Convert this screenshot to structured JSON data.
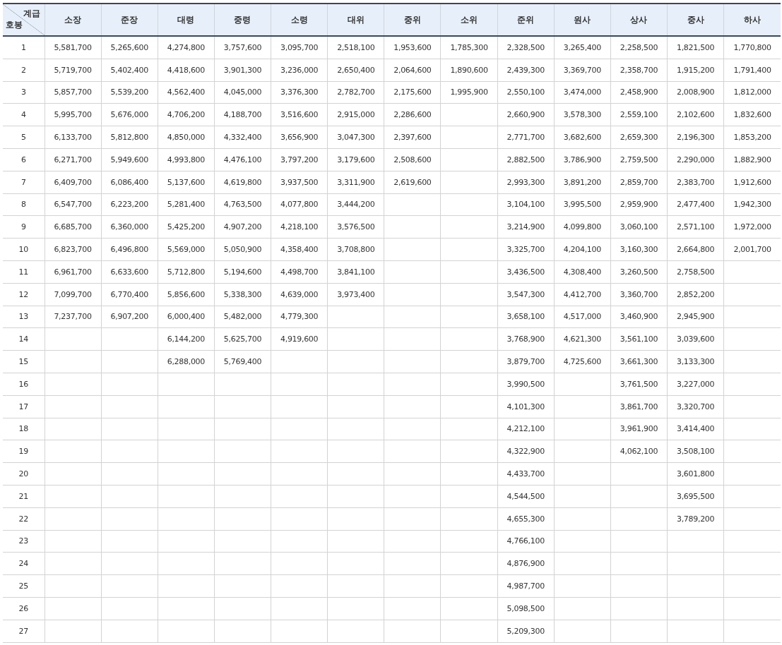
{
  "table": {
    "corner": {
      "column_label": "계급",
      "row_label": "호봉"
    },
    "columns": [
      "소장",
      "준장",
      "대령",
      "중령",
      "소령",
      "대위",
      "중위",
      "소위",
      "준위",
      "원사",
      "상사",
      "중사",
      "하사"
    ],
    "rows": [
      {
        "step": "1",
        "cells": [
          "5,581,700",
          "5,265,600",
          "4,274,800",
          "3,757,600",
          "3,095,700",
          "2,518,100",
          "1,953,600",
          "1,785,300",
          "2,328,500",
          "3,265,400",
          "2,258,500",
          "1,821,500",
          "1,770,800"
        ]
      },
      {
        "step": "2",
        "cells": [
          "5,719,700",
          "5,402,400",
          "4,418,600",
          "3,901,300",
          "3,236,000",
          "2,650,400",
          "2,064,600",
          "1,890,600",
          "2,439,300",
          "3,369,700",
          "2,358,700",
          "1,915,200",
          "1,791,400"
        ]
      },
      {
        "step": "3",
        "cells": [
          "5,857,700",
          "5,539,200",
          "4,562,400",
          "4,045,000",
          "3,376,300",
          "2,782,700",
          "2,175,600",
          "1,995,900",
          "2,550,100",
          "3,474,000",
          "2,458,900",
          "2,008,900",
          "1,812,000"
        ]
      },
      {
        "step": "4",
        "cells": [
          "5,995,700",
          "5,676,000",
          "4,706,200",
          "4,188,700",
          "3,516,600",
          "2,915,000",
          "2,286,600",
          null,
          "2,660,900",
          "3,578,300",
          "2,559,100",
          "2,102,600",
          "1,832,600"
        ]
      },
      {
        "step": "5",
        "cells": [
          "6,133,700",
          "5,812,800",
          "4,850,000",
          "4,332,400",
          "3,656,900",
          "3,047,300",
          "2,397,600",
          null,
          "2,771,700",
          "3,682,600",
          "2,659,300",
          "2,196,300",
          "1,853,200"
        ]
      },
      {
        "step": "6",
        "cells": [
          "6,271,700",
          "5,949,600",
          "4,993,800",
          "4,476,100",
          "3,797,200",
          "3,179,600",
          "2,508,600",
          null,
          "2,882,500",
          "3,786,900",
          "2,759,500",
          "2,290,000",
          "1,882,900"
        ]
      },
      {
        "step": "7",
        "cells": [
          "6,409,700",
          "6,086,400",
          "5,137,600",
          "4,619,800",
          "3,937,500",
          "3,311,900",
          "2,619,600",
          null,
          "2,993,300",
          "3,891,200",
          "2,859,700",
          "2,383,700",
          "1,912,600"
        ]
      },
      {
        "step": "8",
        "cells": [
          "6,547,700",
          "6,223,200",
          "5,281,400",
          "4,763,500",
          "4,077,800",
          "3,444,200",
          null,
          null,
          "3,104,100",
          "3,995,500",
          "2,959,900",
          "2,477,400",
          "1,942,300"
        ]
      },
      {
        "step": "9",
        "cells": [
          "6,685,700",
          "6,360,000",
          "5,425,200",
          "4,907,200",
          "4,218,100",
          "3,576,500",
          null,
          null,
          "3,214,900",
          "4,099,800",
          "3,060,100",
          "2,571,100",
          "1,972,000"
        ]
      },
      {
        "step": "10",
        "cells": [
          "6,823,700",
          "6,496,800",
          "5,569,000",
          "5,050,900",
          "4,358,400",
          "3,708,800",
          null,
          null,
          "3,325,700",
          "4,204,100",
          "3,160,300",
          "2,664,800",
          "2,001,700"
        ]
      },
      {
        "step": "11",
        "cells": [
          "6,961,700",
          "6,633,600",
          "5,712,800",
          "5,194,600",
          "4,498,700",
          "3,841,100",
          null,
          null,
          "3,436,500",
          "4,308,400",
          "3,260,500",
          "2,758,500",
          null
        ]
      },
      {
        "step": "12",
        "cells": [
          "7,099,700",
          "6,770,400",
          "5,856,600",
          "5,338,300",
          "4,639,000",
          "3,973,400",
          null,
          null,
          "3,547,300",
          "4,412,700",
          "3,360,700",
          "2,852,200",
          null
        ]
      },
      {
        "step": "13",
        "cells": [
          "7,237,700",
          "6,907,200",
          "6,000,400",
          "5,482,000",
          "4,779,300",
          null,
          null,
          null,
          "3,658,100",
          "4,517,000",
          "3,460,900",
          "2,945,900",
          null
        ]
      },
      {
        "step": "14",
        "cells": [
          null,
          null,
          "6,144,200",
          "5,625,700",
          "4,919,600",
          null,
          null,
          null,
          "3,768,900",
          "4,621,300",
          "3,561,100",
          "3,039,600",
          null
        ]
      },
      {
        "step": "15",
        "cells": [
          null,
          null,
          "6,288,000",
          "5,769,400",
          null,
          null,
          null,
          null,
          "3,879,700",
          "4,725,600",
          "3,661,300",
          "3,133,300",
          null
        ]
      },
      {
        "step": "16",
        "cells": [
          null,
          null,
          null,
          null,
          null,
          null,
          null,
          null,
          "3,990,500",
          null,
          "3,761,500",
          "3,227,000",
          null
        ]
      },
      {
        "step": "17",
        "cells": [
          null,
          null,
          null,
          null,
          null,
          null,
          null,
          null,
          "4,101,300",
          null,
          "3,861,700",
          "3,320,700",
          null
        ]
      },
      {
        "step": "18",
        "cells": [
          null,
          null,
          null,
          null,
          null,
          null,
          null,
          null,
          "4,212,100",
          null,
          "3,961,900",
          "3,414,400",
          null
        ]
      },
      {
        "step": "19",
        "cells": [
          null,
          null,
          null,
          null,
          null,
          null,
          null,
          null,
          "4,322,900",
          null,
          "4,062,100",
          "3,508,100",
          null
        ]
      },
      {
        "step": "20",
        "cells": [
          null,
          null,
          null,
          null,
          null,
          null,
          null,
          null,
          "4,433,700",
          null,
          null,
          "3,601,800",
          null
        ]
      },
      {
        "step": "21",
        "cells": [
          null,
          null,
          null,
          null,
          null,
          null,
          null,
          null,
          "4,544,500",
          null,
          null,
          "3,695,500",
          null
        ]
      },
      {
        "step": "22",
        "cells": [
          null,
          null,
          null,
          null,
          null,
          null,
          null,
          null,
          "4,655,300",
          null,
          null,
          "3,789,200",
          null
        ]
      },
      {
        "step": "23",
        "cells": [
          null,
          null,
          null,
          null,
          null,
          null,
          null,
          null,
          "4,766,100",
          null,
          null,
          null,
          null
        ]
      },
      {
        "step": "24",
        "cells": [
          null,
          null,
          null,
          null,
          null,
          null,
          null,
          null,
          "4,876,900",
          null,
          null,
          null,
          null
        ]
      },
      {
        "step": "25",
        "cells": [
          null,
          null,
          null,
          null,
          null,
          null,
          null,
          null,
          "4,987,700",
          null,
          null,
          null,
          null
        ]
      },
      {
        "step": "26",
        "cells": [
          null,
          null,
          null,
          null,
          null,
          null,
          null,
          null,
          "5,098,500",
          null,
          null,
          null,
          null
        ]
      },
      {
        "step": "27",
        "cells": [
          null,
          null,
          null,
          null,
          null,
          null,
          null,
          null,
          "5,209,300",
          null,
          null,
          null,
          null
        ]
      }
    ]
  }
}
